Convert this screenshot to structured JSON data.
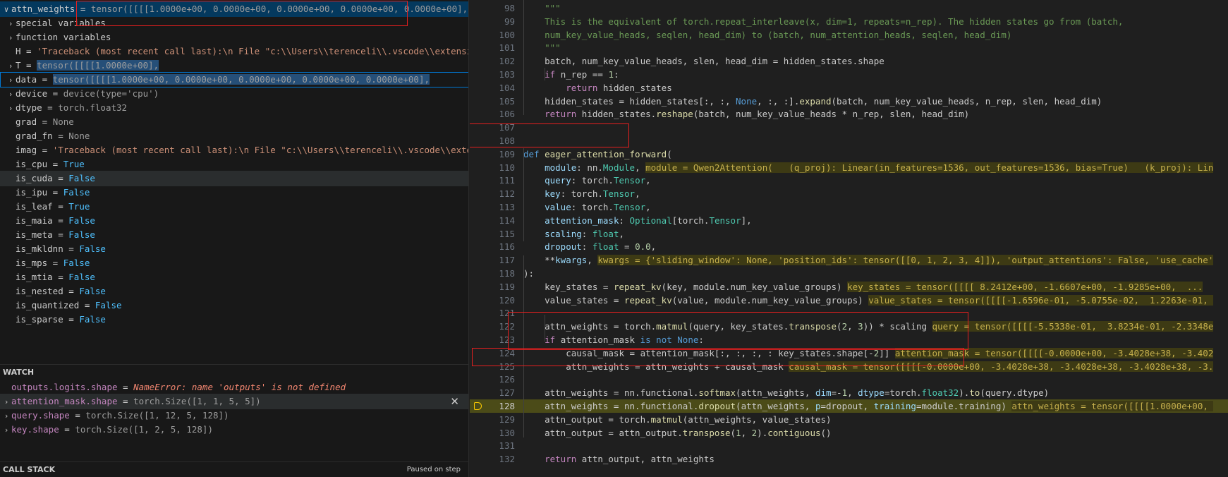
{
  "variables": {
    "rows": [
      {
        "tw": "∨",
        "name": "attn_weights",
        "value": "tensor([[[[1.0000e+00, 0.0000e+00, 0.0000e+00, 0.0000e+00, 0.0000e+00],",
        "kind": "plain",
        "level": 0
      },
      {
        "tw": "›",
        "name": "special variables",
        "value": "",
        "kind": "plain",
        "level": 1
      },
      {
        "tw": "›",
        "name": "function variables",
        "value": "",
        "kind": "plain",
        "level": 1
      },
      {
        "tw": "",
        "name": "H",
        "value": "'Traceback (most recent call last):\\n  File \"c:\\\\Users\\\\terenceli\\\\.vscode\\\\extensio...",
        "kind": "str",
        "level": 1
      },
      {
        "tw": "›",
        "name": "T",
        "value": "tensor([[[[1.0000e+00],",
        "kind": "plain",
        "level": 1
      },
      {
        "tw": "›",
        "name": "data",
        "value": "tensor([[[[1.0000e+00, 0.0000e+00, 0.0000e+00, 0.0000e+00, 0.0000e+00],",
        "kind": "plain",
        "level": 1
      },
      {
        "tw": "›",
        "name": "device",
        "value": "device(type='cpu')",
        "kind": "plain",
        "level": 1
      },
      {
        "tw": "›",
        "name": "dtype",
        "value": "torch.float32",
        "kind": "plain",
        "level": 1
      },
      {
        "tw": "",
        "name": "grad",
        "value": "None",
        "kind": "plain",
        "level": 1
      },
      {
        "tw": "",
        "name": "grad_fn",
        "value": "None",
        "kind": "plain",
        "level": 1
      },
      {
        "tw": "",
        "name": "imag",
        "value": "'Traceback (most recent call last):\\n  File \"c:\\\\Users\\\\terenceli\\\\.vscode\\\\exten...",
        "kind": "str",
        "level": 1
      },
      {
        "tw": "",
        "name": "is_cpu",
        "value": "True",
        "kind": "bool",
        "level": 1
      },
      {
        "tw": "",
        "name": "is_cuda",
        "value": "False",
        "kind": "bool",
        "level": 1
      },
      {
        "tw": "",
        "name": "is_ipu",
        "value": "False",
        "kind": "bool",
        "level": 1
      },
      {
        "tw": "",
        "name": "is_leaf",
        "value": "True",
        "kind": "bool",
        "level": 1
      },
      {
        "tw": "",
        "name": "is_maia",
        "value": "False",
        "kind": "bool",
        "level": 1
      },
      {
        "tw": "",
        "name": "is_meta",
        "value": "False",
        "kind": "bool",
        "level": 1
      },
      {
        "tw": "",
        "name": "is_mkldnn",
        "value": "False",
        "kind": "bool",
        "level": 1
      },
      {
        "tw": "",
        "name": "is_mps",
        "value": "False",
        "kind": "bool",
        "level": 1
      },
      {
        "tw": "",
        "name": "is_mtia",
        "value": "False",
        "kind": "bool",
        "level": 1
      },
      {
        "tw": "",
        "name": "is_nested",
        "value": "False",
        "kind": "bool",
        "level": 1
      },
      {
        "tw": "",
        "name": "is_quantized",
        "value": "False",
        "kind": "bool",
        "level": 1
      },
      {
        "tw": "",
        "name": "is_sparse",
        "value": "False",
        "kind": "bool",
        "level": 1
      }
    ]
  },
  "watch": {
    "title": "WATCH",
    "items": [
      {
        "tw": "",
        "name": "outputs.logits.shape",
        "value": "NameError: name 'outputs' is not defined",
        "kind": "err"
      },
      {
        "tw": "›",
        "name": "attention_mask.shape",
        "value": "torch.Size([1, 1, 5, 5])",
        "kind": "plain"
      },
      {
        "tw": "›",
        "name": "query.shape",
        "value": "torch.Size([1, 12, 5, 128])",
        "kind": "plain"
      },
      {
        "tw": "›",
        "name": "key.shape",
        "value": "torch.Size([1, 2, 5, 128])",
        "kind": "plain"
      }
    ],
    "remove_glyph": "✕"
  },
  "callstack": {
    "title": "CALL STACK",
    "status": "Paused on step"
  },
  "editor": {
    "current_line": "128",
    "lines": [
      {
        "n": "98",
        "html": "    <span class=\"cm\">\"\"\"</span>"
      },
      {
        "n": "99",
        "html": "    <span class=\"cm\">This is the equivalent of torch.repeat_interleave(x, dim=1, repeats=n_rep). The hidden states go from (batch,</span>"
      },
      {
        "n": "100",
        "html": "    <span class=\"cm\">num_key_value_heads, seqlen, head_dim) to (batch, num_attention_heads, seqlen, head_dim)</span>"
      },
      {
        "n": "101",
        "html": "    <span class=\"cm\">\"\"\"</span>"
      },
      {
        "n": "102",
        "html": "    batch, num_key_value_heads, slen, head_dim = hidden_states.shape"
      },
      {
        "n": "103",
        "html": "    <span class=\"kw\">if</span> n_rep == <span class=\"num\">1</span>:"
      },
      {
        "n": "104",
        "html": "        <span class=\"kw\">return</span> hidden_states"
      },
      {
        "n": "105",
        "html": "    hidden_states = hidden_states[:, :, <span class=\"kw2\">None</span>, :, :].<span class=\"fn\">expand</span>(batch, num_key_value_heads, n_rep, slen, head_dim)"
      },
      {
        "n": "106",
        "html": "    <span class=\"kw\">return</span> hidden_states.<span class=\"fn\">reshape</span>(batch, num_key_value_heads * n_rep, slen, head_dim)"
      },
      {
        "n": "107",
        "html": ""
      },
      {
        "n": "108",
        "html": ""
      },
      {
        "n": "109",
        "html": "<span class=\"kw2\">def</span> <span class=\"fn\">eager_attention_forward</span>("
      },
      {
        "n": "110",
        "html": "    <span class=\"pm\">module</span>: nn.<span class=\"ty\">Module</span>, <span class=\"inl\">module = Qwen2Attention(   (q_proj): Linear(in_features=1536, out_features=1536, bias=True)   (k_proj): Lin</span>"
      },
      {
        "n": "111",
        "html": "    <span class=\"pm\">query</span>: torch.<span class=\"ty\">Tensor</span>,"
      },
      {
        "n": "112",
        "html": "    <span class=\"pm\">key</span>: torch.<span class=\"ty\">Tensor</span>,"
      },
      {
        "n": "113",
        "html": "    <span class=\"pm\">value</span>: torch.<span class=\"ty\">Tensor</span>,"
      },
      {
        "n": "114",
        "html": "    <span class=\"pm\">attention_mask</span>: <span class=\"ty\">Optional</span>[torch.<span class=\"ty\">Tensor</span>],"
      },
      {
        "n": "115",
        "html": "    <span class=\"pm\">scaling</span>: <span class=\"ty\">float</span>,"
      },
      {
        "n": "116",
        "html": "    <span class=\"pm\">dropout</span>: <span class=\"ty\">float</span> = <span class=\"num\">0.0</span>,"
      },
      {
        "n": "117",
        "html": "    **<span class=\"pm\">kwargs</span>, <span class=\"inl\">kwargs = {'sliding_window': None, 'position_ids': tensor([[0, 1, 2, 3, 4]]), 'output_attentions': False, 'use_cache'</span>"
      },
      {
        "n": "118",
        "html": "):"
      },
      {
        "n": "119",
        "html": "    key_states = <span class=\"fn\">repeat_kv</span>(key, module.num_key_value_groups) <span class=\"inl\">key_states = tensor([[[[ 8.2412e+00, -1.6607e+00, -1.9285e+00,  ...</span>"
      },
      {
        "n": "120",
        "html": "    value_states = <span class=\"fn\">repeat_kv</span>(value, module.num_key_value_groups) <span class=\"inl\">value_states = tensor([[[[-1.6596e-01, -5.0755e-02,  1.2263e-01, </span>"
      },
      {
        "n": "121",
        "html": ""
      },
      {
        "n": "122",
        "html": "    attn_weights = torch.<span class=\"fn\">matmul</span>(query, key_states.<span class=\"fn\">transpose</span>(<span class=\"num\">2</span>, <span class=\"num\">3</span>)) * scaling <span class=\"inl\">query = tensor([[[[-5.5338e-01,  3.8234e-01, -2.3348e</span>"
      },
      {
        "n": "123",
        "html": "    <span class=\"kw\">if</span> attention_mask <span class=\"kw2\">is not</span> <span class=\"kw2\">None</span>:"
      },
      {
        "n": "124",
        "html": "        causal_mask = attention_mask[:, :, :, : key_states.shape[-<span class=\"num\">2</span>]] <span class=\"inl\">attention_mask = tensor([[[[-0.0000e+00, -3.4028e+38, -3.402</span>"
      },
      {
        "n": "125",
        "html": "        attn_weights = attn_weights + causal_mask <span class=\"inl\">causal_mask = tensor([[[[-0.0000e+00, -3.4028e+38, -3.4028e+38, -3.4028e+38, -3.</span>"
      },
      {
        "n": "126",
        "html": ""
      },
      {
        "n": "127",
        "html": "    attn_weights = nn.functional.<span class=\"fn\">softmax</span>(attn_weights, <span class=\"pm\">dim</span>=-<span class=\"num\">1</span>, <span class=\"pm\">dtype</span>=torch.<span class=\"ty\">float32</span>).<span class=\"fn\">to</span>(query.dtype)"
      },
      {
        "n": "128",
        "html": "    attn_weights = nn.functional.<span class=\"fn\">dropout</span>(attn_weights, <span class=\"pm\">p</span>=dropout, <span class=\"pm\">training</span>=module.training) <span class=\"inl\">attn_weights = tensor([[[[1.0000e+00, </span>"
      },
      {
        "n": "129",
        "html": "    attn_output = torch.<span class=\"fn\">matmul</span>(attn_weights, value_states)"
      },
      {
        "n": "130",
        "html": "    attn_output = attn_output.<span class=\"fn\">transpose</span>(<span class=\"num\">1</span>, <span class=\"num\">2</span>).<span class=\"fn\">contiguous</span>()"
      },
      {
        "n": "131",
        "html": ""
      },
      {
        "n": "132",
        "html": "    <span class=\"kw\">return</span> attn_output, attn_weights"
      }
    ]
  }
}
